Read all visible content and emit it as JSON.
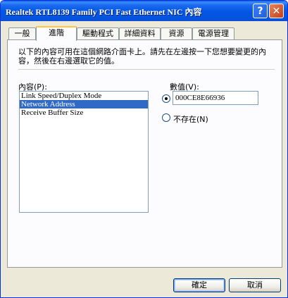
{
  "window": {
    "title": "Realtek RTL8139 Family PCI Fast Ethernet NIC 內容",
    "help_symbol": "?",
    "close_symbol": "✕"
  },
  "tabs": [
    {
      "label": "一般",
      "active": false
    },
    {
      "label": "進階",
      "active": true
    },
    {
      "label": "驅動程式",
      "active": false
    },
    {
      "label": "詳細資料",
      "active": false
    },
    {
      "label": "資源",
      "active": false
    },
    {
      "label": "電源管理",
      "active": false
    }
  ],
  "advanced": {
    "intro_text": "以下的內容可用在這個網路介面卡上。請先在左邊按一下您想要變更的內容，然後在右邊選取它的值。",
    "property_label": "內容(P):",
    "properties": [
      {
        "label": "Link Speed/Duplex Mode",
        "selected": false
      },
      {
        "label": "Network Address",
        "selected": true
      },
      {
        "label": "Receive Buffer Size",
        "selected": false
      }
    ],
    "value_label": "數值(V):",
    "value_option_selected": "value",
    "value_input": "000CE8E66936",
    "not_present_label": "不存在(N)"
  },
  "buttons": {
    "ok_label": "確定",
    "cancel_label": "取消"
  }
}
